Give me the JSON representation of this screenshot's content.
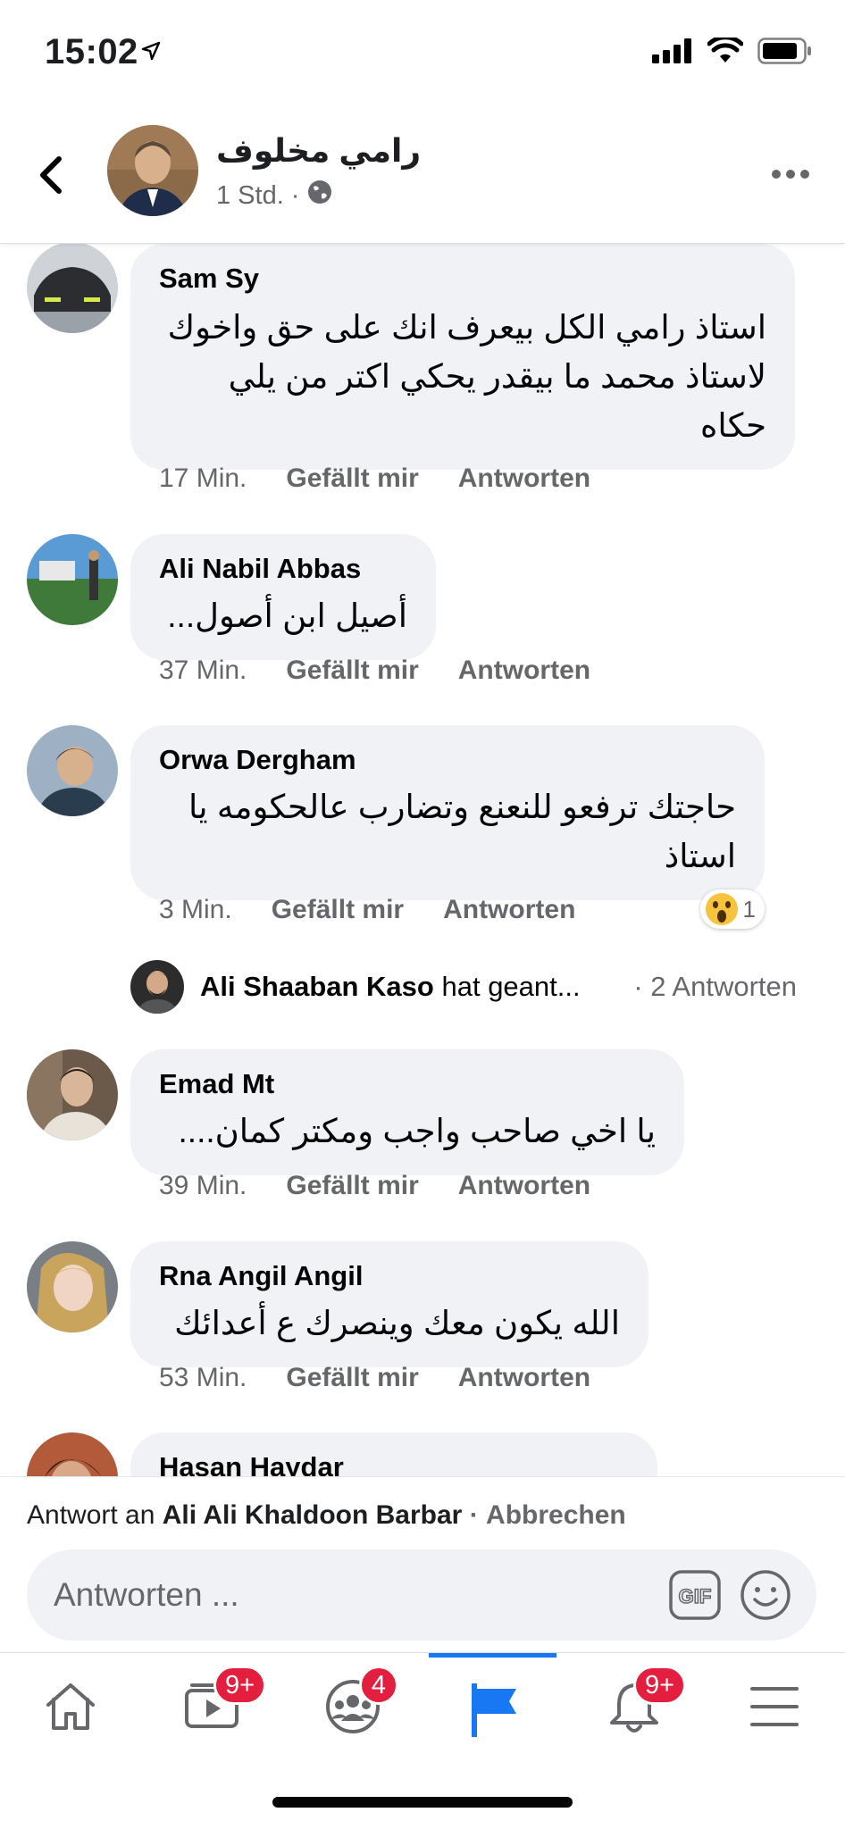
{
  "status": {
    "time": "15:02"
  },
  "post": {
    "author": "رامي مخلوف",
    "time": "1 Std.",
    "separator": "·"
  },
  "comments": [
    {
      "name": "Sam Sy",
      "text": "استاذ رامي الكل بيعرف انك على حق واخوك لاستاذ محمد ما بيقدر يحكي اكتر من يلي حكاه",
      "time": "17 Min.",
      "like": "Gefällt mir",
      "reply": "Antworten"
    },
    {
      "name": "Ali Nabil Abbas",
      "text": "أصيل ابن أصول...",
      "time": "37 Min.",
      "like": "Gefällt mir",
      "reply": "Antworten"
    },
    {
      "name": "Orwa Dergham",
      "text": "حاجتك ترفعو للنعنع وتضارب عالحكومه يا استاذ",
      "time": "3 Min.",
      "like": "Gefällt mir",
      "reply": "Antworten",
      "reaction_count": "1"
    },
    {
      "name": "Emad Mt",
      "text": "يا اخي صاحب واجب ومكتر كمان....",
      "time": "39 Min.",
      "like": "Gefällt mir",
      "reply": "Antworten"
    },
    {
      "name": "Rna Angil Angil",
      "text": "الله يكون معك وينصرك ع أعدائك",
      "time": "53 Min.",
      "like": "Gefällt mir",
      "reply": "Antworten"
    },
    {
      "name": "Hasan Haydar"
    }
  ],
  "reply_summary": {
    "name": "Ali Shaaban Kaso",
    "text": "hat geant...",
    "count": "· 2 Antworten"
  },
  "reply_bar": {
    "prefix": "Antwort an",
    "name": "Ali Ali Khaldoon Barbar",
    "sep": "·",
    "cancel": "Abbrechen"
  },
  "compose": {
    "placeholder": "Antworten ...",
    "gif": "GIF"
  },
  "tabs": {
    "watch_badge": "9+",
    "groups_badge": "4",
    "notifications_badge": "9+"
  },
  "colors": {
    "accent": "#1877f2",
    "badge": "#e41e3f",
    "bubble": "#f0f2f5"
  }
}
